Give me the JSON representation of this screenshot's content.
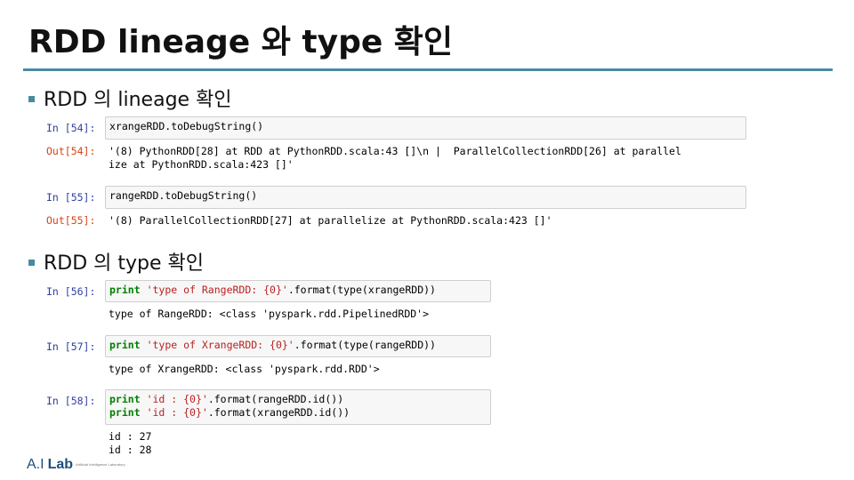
{
  "slide": {
    "title": "RDD lineage 와 type 확인",
    "bullets": [
      "RDD 의 lineage 확인",
      "RDD 의 type 확인"
    ]
  },
  "cells": [
    {
      "in_prompt": "In [54]:",
      "code": [
        "xrangeRDD.toDebugString()"
      ],
      "out_prompt": "Out[54]:",
      "output": [
        "'(8) PythonRDD[28] at RDD at PythonRDD.scala:43 []\\n |  ParallelCollectionRDD[26] at parallel",
        "ize at PythonRDD.scala:423 []'"
      ]
    },
    {
      "in_prompt": "In [55]:",
      "code": [
        "rangeRDD.toDebugString()"
      ],
      "out_prompt": "Out[55]:",
      "output": [
        "'(8) ParallelCollectionRDD[27] at parallelize at PythonRDD.scala:423 []'"
      ]
    },
    {
      "in_prompt": "In [56]:",
      "code_parts": {
        "kw": "print",
        "str": "'type of RangeRDD: {0}'",
        "rest": ".format(type(xrangeRDD))"
      },
      "output": [
        "type of RangeRDD: <class 'pyspark.rdd.PipelinedRDD'>"
      ]
    },
    {
      "in_prompt": "In [57]:",
      "code_parts": {
        "kw": "print",
        "str": "'type of XrangeRDD: {0}'",
        "rest": ".format(type(rangeRDD))"
      },
      "output": [
        "type of XrangeRDD: <class 'pyspark.rdd.RDD'>"
      ]
    },
    {
      "in_prompt": "In [58]:",
      "code_lines": [
        {
          "kw": "print",
          "str": "'id : {0}'",
          "rest": ".format(rangeRDD.id())"
        },
        {
          "kw": "print",
          "str": "'id : {0}'",
          "rest": ".format(xrangeRDD.id())"
        }
      ],
      "output": [
        "id : 27",
        "id : 28"
      ]
    }
  ],
  "logo": {
    "mark": "A.I",
    "lab": "Lab",
    "subtitle": "Artificial Intelligence Laboratory"
  }
}
